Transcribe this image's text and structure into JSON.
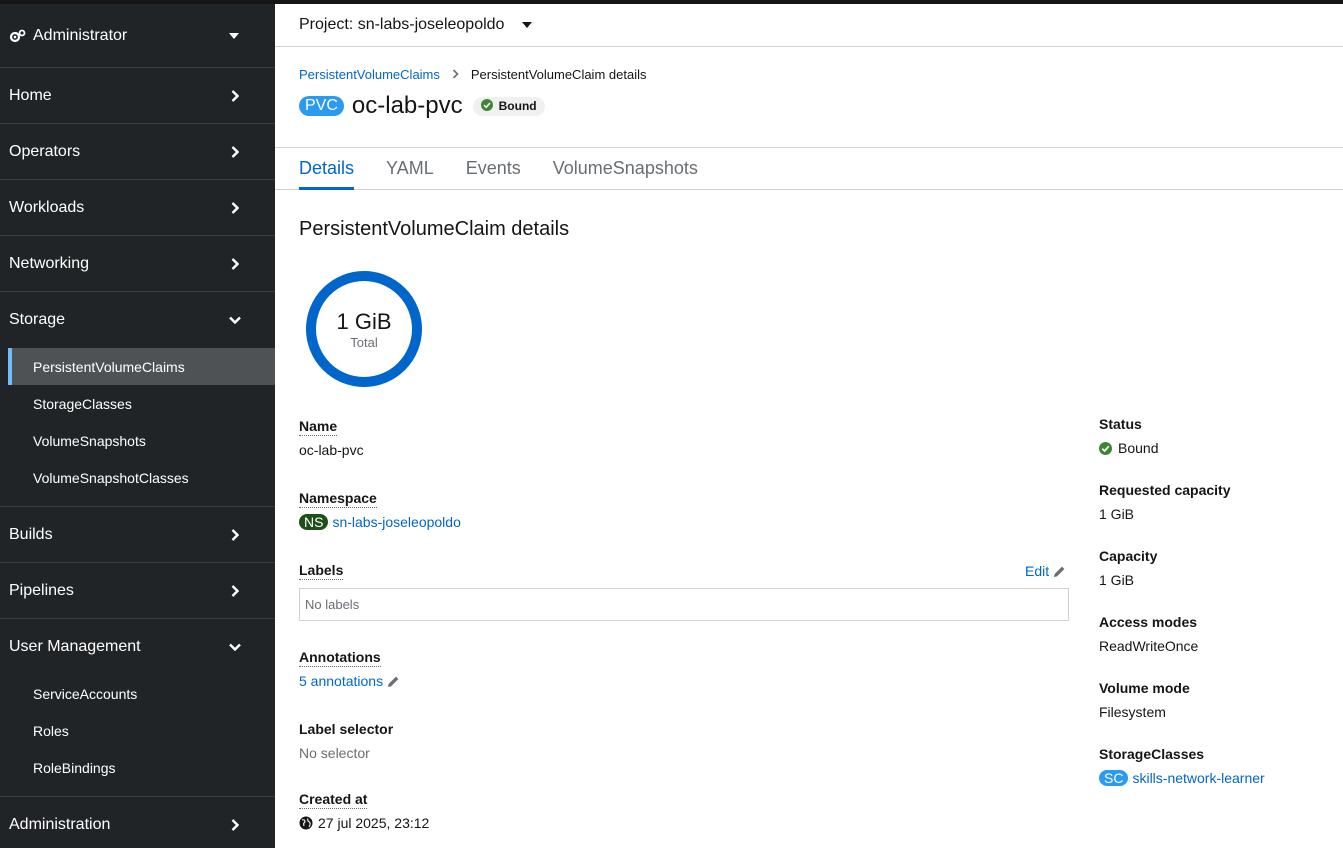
{
  "sidebar": {
    "perspective": "Administrator",
    "items": [
      {
        "label": "Home"
      },
      {
        "label": "Operators"
      },
      {
        "label": "Workloads"
      },
      {
        "label": "Networking"
      },
      {
        "label": "Storage"
      },
      {
        "label": "Builds"
      },
      {
        "label": "Pipelines"
      },
      {
        "label": "User Management"
      },
      {
        "label": "Administration"
      }
    ],
    "storage_sub": [
      "PersistentVolumeClaims",
      "StorageClasses",
      "VolumeSnapshots",
      "VolumeSnapshotClasses"
    ],
    "user_sub": [
      "ServiceAccounts",
      "Roles",
      "RoleBindings"
    ]
  },
  "project": {
    "label": "Project: sn-labs-joseleopoldo"
  },
  "breadcrumb": {
    "parent": "PersistentVolumeClaims",
    "current": "PersistentVolumeClaim details"
  },
  "header": {
    "badge": "PVC",
    "title": "oc-lab-pvc",
    "status": "Bound"
  },
  "tabs": [
    "Details",
    "YAML",
    "Events",
    "VolumeSnapshots"
  ],
  "details": {
    "section_title": "PersistentVolumeClaim details",
    "donut": {
      "value": "1 GiB",
      "caption": "Total",
      "fill_fraction": 1.0
    },
    "name_label": "Name",
    "name_value": "oc-lab-pvc",
    "namespace_label": "Namespace",
    "namespace_badge": "NS",
    "namespace_value": "sn-labs-joseleopoldo",
    "labels_label": "Labels",
    "labels_edit": "Edit",
    "labels_empty": "No labels",
    "annotations_label": "Annotations",
    "annotations_value": "5 annotations",
    "selector_label": "Label selector",
    "selector_value": "No selector",
    "created_label": "Created at",
    "created_value": "27 jul 2025, 23:12",
    "status_label": "Status",
    "status_value": "Bound",
    "req_cap_label": "Requested capacity",
    "req_cap_value": "1 GiB",
    "cap_label": "Capacity",
    "cap_value": "1 GiB",
    "access_label": "Access modes",
    "access_value": "ReadWriteOnce",
    "volmode_label": "Volume mode",
    "volmode_value": "Filesystem",
    "sc_label": "StorageClasses",
    "sc_badge": "SC",
    "sc_value": "skills-network-learner"
  },
  "colors": {
    "accent": "#0066cc",
    "sidebar_bg": "#212427",
    "success": "#3e8635",
    "donut": "#0066cc"
  }
}
